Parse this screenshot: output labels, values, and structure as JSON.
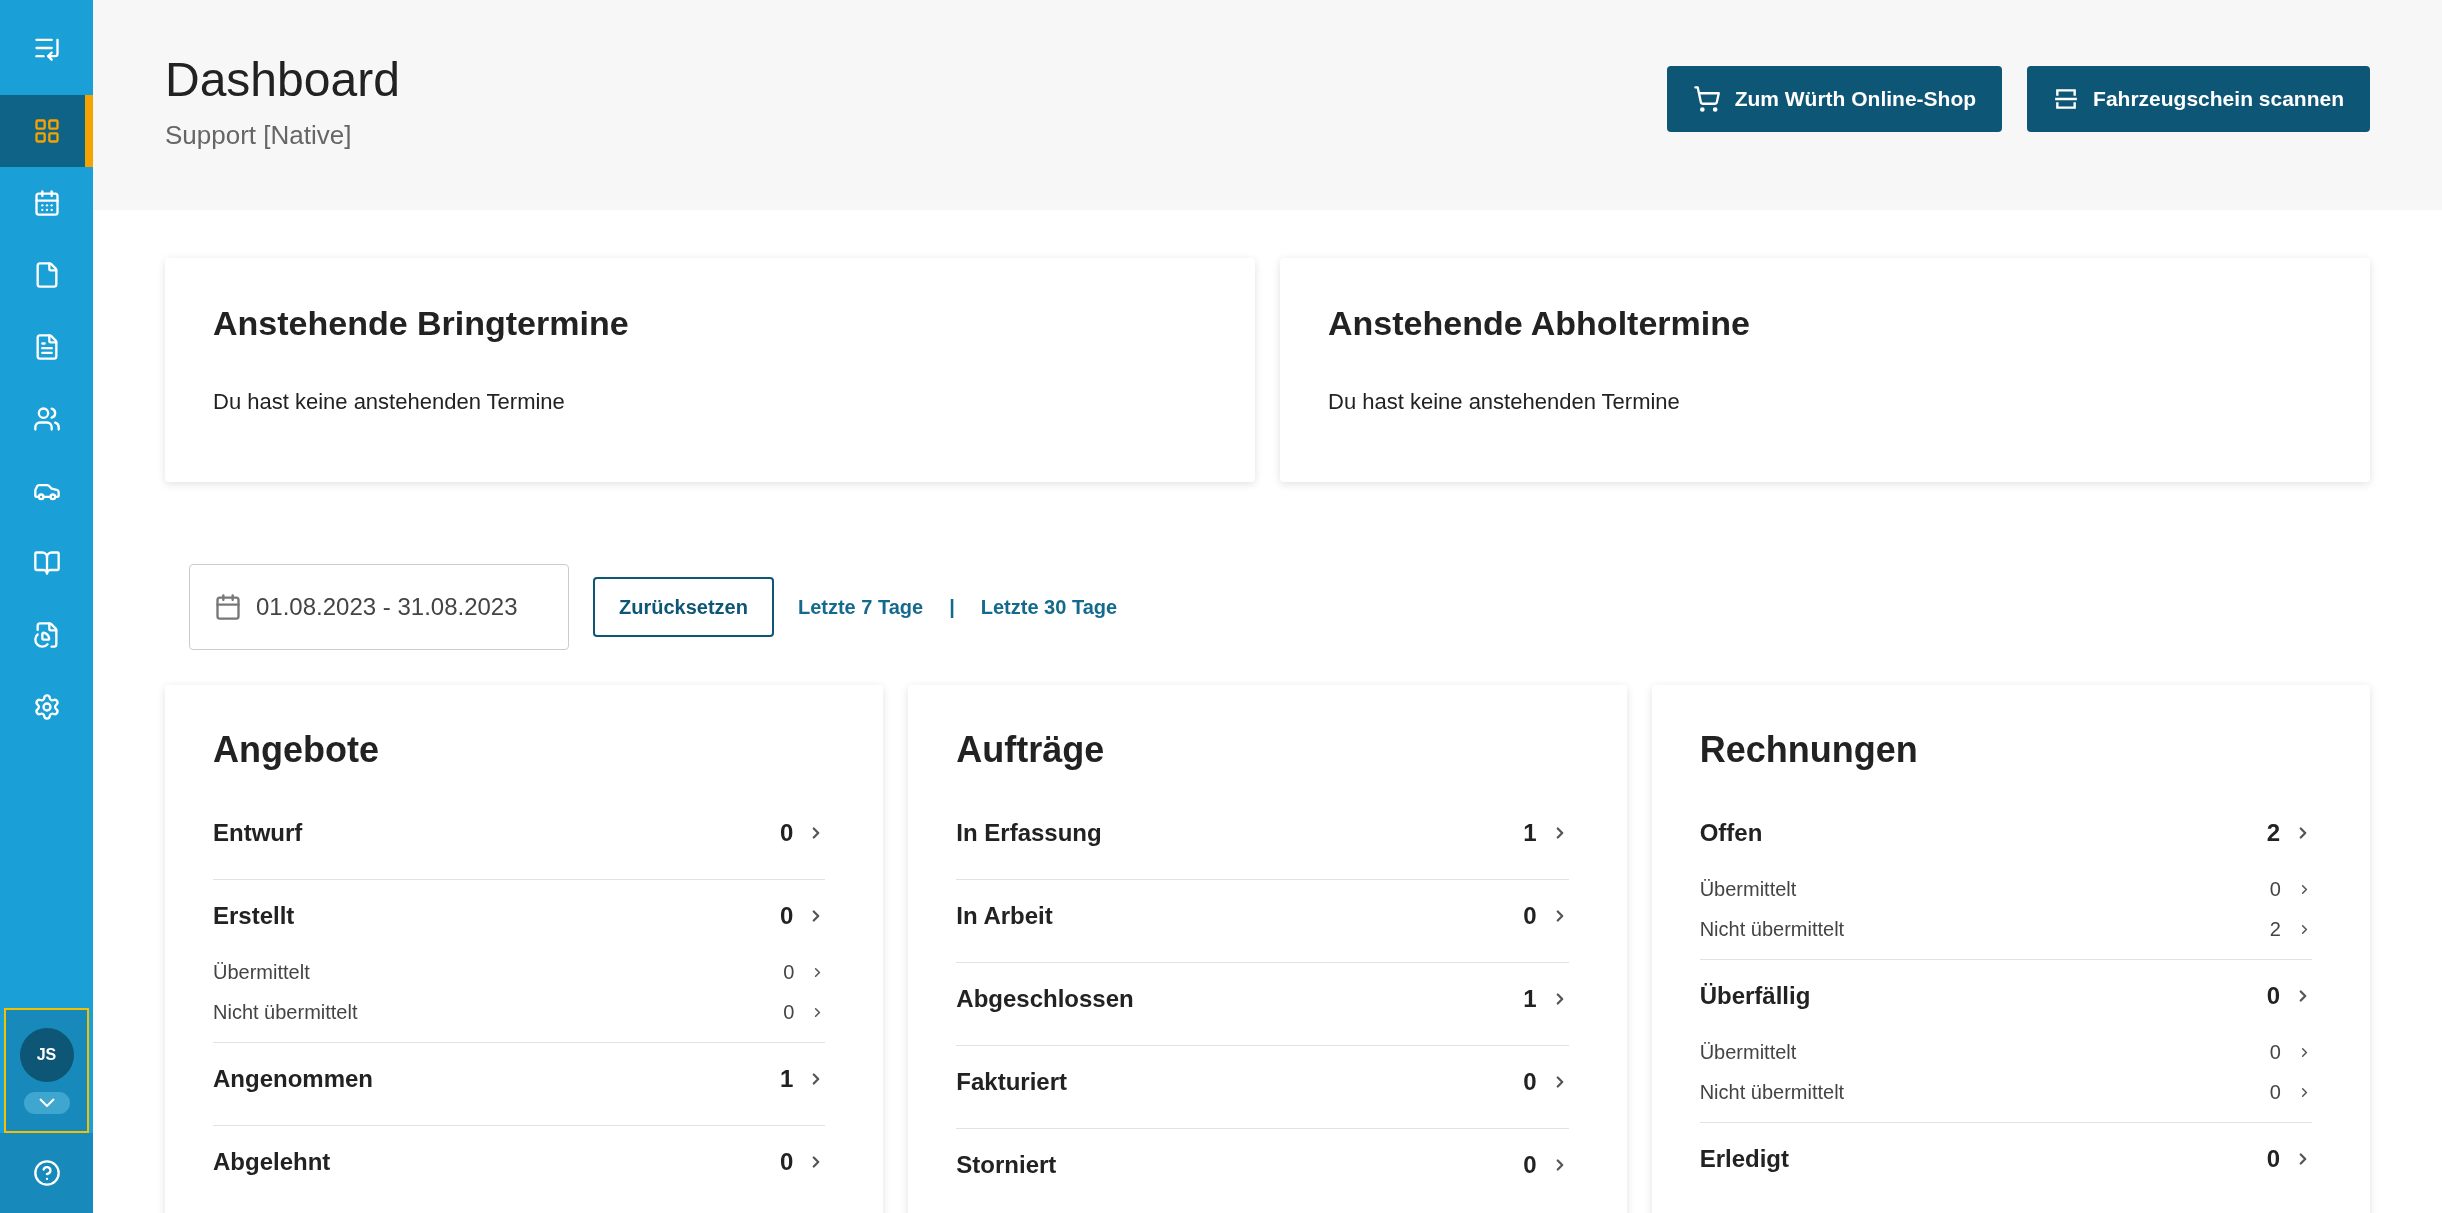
{
  "sidebar": {
    "items": [
      {
        "kind": "grid",
        "selected": true
      },
      {
        "kind": "calendar",
        "selected": false
      },
      {
        "kind": "file",
        "selected": false
      },
      {
        "kind": "document",
        "selected": false
      },
      {
        "kind": "users",
        "selected": false
      },
      {
        "kind": "car",
        "selected": false
      },
      {
        "kind": "book",
        "selected": false
      },
      {
        "kind": "report",
        "selected": false
      },
      {
        "kind": "settings",
        "selected": false
      }
    ],
    "user": {
      "initials": "JS"
    }
  },
  "header": {
    "title": "Dashboard",
    "subtitle": "Support [Native]",
    "buttons": [
      {
        "kind": "cart",
        "label": "Zum Würth Online-Shop"
      },
      {
        "kind": "scan",
        "label": "Fahrzeugschein scannen"
      }
    ]
  },
  "appointments": [
    {
      "title": "Anstehende Bringtermine",
      "text": "Du hast keine anstehenden Termine"
    },
    {
      "title": "Anstehende Abholtermine",
      "text": "Du hast keine anstehenden Termine"
    }
  ],
  "filter": {
    "date_range": "01.08.2023 - 31.08.2023",
    "reset": "Zurücksetzen",
    "links": [
      "Letzte 7 Tage",
      "Letzte 30 Tage"
    ],
    "separator": "|"
  },
  "stats": [
    {
      "title": "Angebote",
      "groups": [
        {
          "label": "Entwurf",
          "count": "0"
        },
        {
          "label": "Erstellt",
          "count": "0",
          "sub": [
            {
              "label": "Übermittelt",
              "count": "0"
            },
            {
              "label": "Nicht übermittelt",
              "count": "0"
            }
          ]
        },
        {
          "label": "Angenommen",
          "count": "1"
        },
        {
          "label": "Abgelehnt",
          "count": "0"
        }
      ]
    },
    {
      "title": "Aufträge",
      "groups": [
        {
          "label": "In Erfassung",
          "count": "1"
        },
        {
          "label": "In Arbeit",
          "count": "0"
        },
        {
          "label": "Abgeschlossen",
          "count": "1"
        },
        {
          "label": "Fakturiert",
          "count": "0"
        },
        {
          "label": "Storniert",
          "count": "0"
        }
      ]
    },
    {
      "title": "Rechnungen",
      "groups": [
        {
          "label": "Offen",
          "count": "2",
          "sub": [
            {
              "label": "Übermittelt",
              "count": "0"
            },
            {
              "label": "Nicht übermittelt",
              "count": "2"
            }
          ]
        },
        {
          "label": "Überfällig",
          "count": "0",
          "sub": [
            {
              "label": "Übermittelt",
              "count": "0"
            },
            {
              "label": "Nicht übermittelt",
              "count": "0"
            }
          ]
        },
        {
          "label": "Erledigt",
          "count": "0"
        }
      ]
    }
  ]
}
